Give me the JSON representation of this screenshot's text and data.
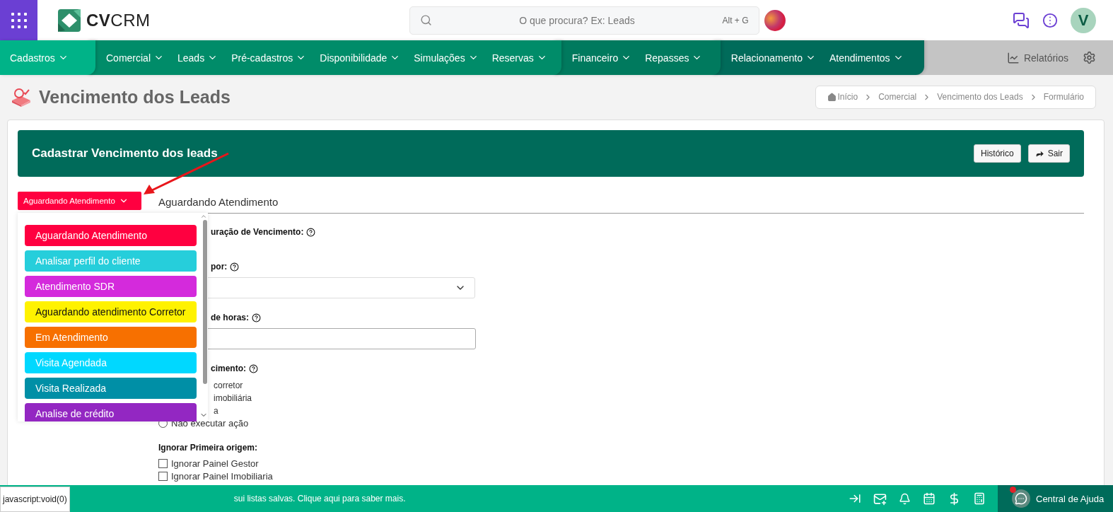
{
  "topbar": {
    "logo": "**CV**CRM",
    "search": {
      "placeholder": "O que procura? Ex: Leads",
      "shortcut": "Alt + G"
    },
    "user_initial": "V"
  },
  "nav": [
    {
      "color": "#00b388",
      "items": [
        "Cadastros"
      ]
    },
    {
      "color": "#008c69",
      "items": [
        "Comercial",
        "Leads",
        "Pré-cadastros",
        "Disponibilidade",
        "Simulações",
        "Reservas"
      ]
    },
    {
      "color": "#007a5e",
      "items": [
        "Financeiro",
        "Repasses"
      ]
    },
    {
      "color": "#006b5a",
      "items": [
        "Relacionamento",
        "Atendimentos"
      ]
    }
  ],
  "nav_right": {
    "reports": "Relatórios"
  },
  "page_title": "Vencimento dos Leads",
  "breadcrumb": [
    "Início",
    "Comercial",
    "Vencimento dos Leads",
    "Formulário"
  ],
  "header": {
    "title": "Cadastrar Vencimento dos leads",
    "buttons": [
      {
        "label": "Histórico",
        "kind": "plain"
      },
      {
        "label": "Sair",
        "kind": "exit"
      }
    ]
  },
  "status_button": "Aguardando Atendimento",
  "section_title": "Aguardando Atendimento",
  "status_menu": [
    {
      "label": "Aguardando Atendimento",
      "color": "#ff0040"
    },
    {
      "label": "Analisar perfil do cliente",
      "color": "#26cedb"
    },
    {
      "label": "Atendimento SDR",
      "color": "#d42adc"
    },
    {
      "label": "Aguardando atendimento Corretor",
      "color": "#fff200"
    },
    {
      "label": "Em Atendimento",
      "color": "#f77000"
    },
    {
      "label": "Visita Agendada",
      "color": "#00d8ff"
    },
    {
      "label": "Visita Realizada",
      "color": "#008fa6"
    },
    {
      "label": "Analise de crédito",
      "color": "#9327c2"
    }
  ],
  "form": [
    {
      "kind": "label",
      "text": "uração de Vencimento:",
      "help": true
    },
    {
      "kind": "label",
      "text": "por:",
      "help": true
    },
    {
      "kind": "select"
    },
    {
      "kind": "label",
      "text": "de horas:",
      "help": true
    },
    {
      "kind": "input"
    },
    {
      "kind": "label",
      "text": "cimento:",
      "help": true
    },
    {
      "kind": "option_text",
      "text": "corretor"
    },
    {
      "kind": "option_text",
      "text": "imobiliária"
    },
    {
      "kind": "option_text",
      "text": "a"
    },
    {
      "kind": "radio",
      "text": "Não executar ação",
      "selected": false
    },
    {
      "kind": "heading",
      "text": "Ignorar Primeira origem:",
      "help": false
    },
    {
      "kind": "checkbox",
      "text": "Ignorar Painel Gestor",
      "checked": false
    },
    {
      "kind": "checkbox",
      "text": "Ignorar Painel Imobiliaria",
      "checked": false
    }
  ],
  "footer": {
    "message": "sui listas salvas. Clique aqui para saber mais.",
    "tooltip": "javascript:void(0)",
    "help": "Central de Ajuda"
  }
}
